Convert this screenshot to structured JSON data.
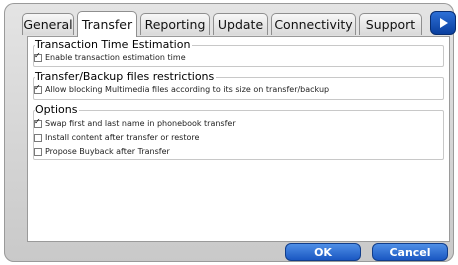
{
  "tabs": [
    {
      "label": "General",
      "active": false
    },
    {
      "label": "Transfer",
      "active": true
    },
    {
      "label": "Reporting",
      "active": false
    },
    {
      "label": "Update",
      "active": false
    },
    {
      "label": "Connectivity",
      "active": false
    },
    {
      "label": "Support",
      "active": false
    }
  ],
  "tab_scroll": {
    "icon": "play-right-icon"
  },
  "sections": {
    "time_estimation": {
      "title": "Transaction Time Estimation",
      "options": [
        {
          "label": "Enable transaction estimation time",
          "checked": true
        }
      ]
    },
    "restrictions": {
      "title": "Transfer/Backup files restrictions",
      "options": [
        {
          "label": "Allow blocking Multimedia files according to its size on transfer/backup",
          "checked": true
        }
      ]
    },
    "options": {
      "title": "Options",
      "options": [
        {
          "label": "Swap first and last name in phonebook transfer",
          "checked": true
        },
        {
          "label": "Install content after transfer or restore",
          "checked": false
        },
        {
          "label": "Propose Buyback after Transfer",
          "checked": false
        }
      ]
    }
  },
  "buttons": {
    "ok": "OK",
    "cancel": "Cancel"
  },
  "colors": {
    "accent": "#1a57c2",
    "tab_arrow": "#0a3f9e"
  }
}
